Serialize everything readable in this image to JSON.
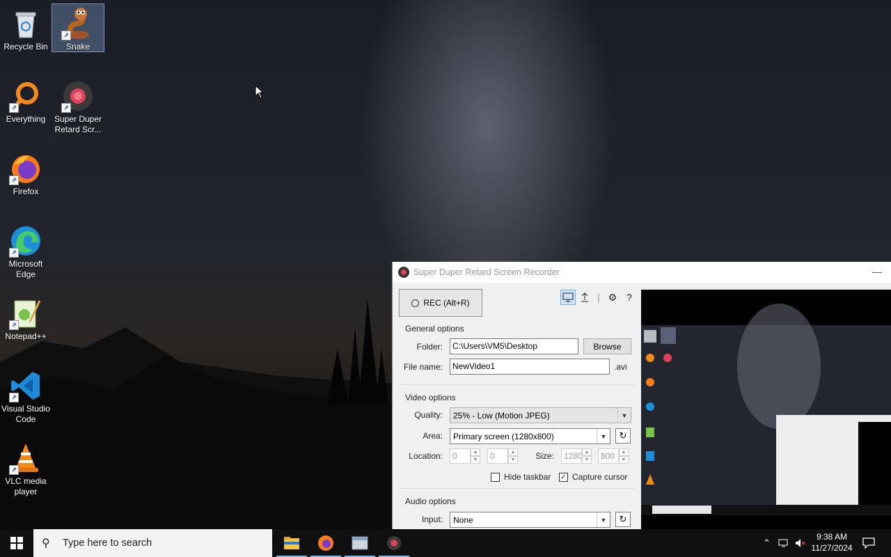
{
  "desktop": {
    "icons": [
      {
        "label": "Recycle Bin"
      },
      {
        "label": "Snake"
      },
      {
        "label": "Everything"
      },
      {
        "label": "Super Duper Retard Scr..."
      },
      {
        "label": "Firefox"
      },
      {
        "label": "Microsoft Edge"
      },
      {
        "label": "Notepad++"
      },
      {
        "label": "Visual Studio Code"
      },
      {
        "label": "VLC media player"
      }
    ]
  },
  "app": {
    "title": "Super Duper Retard Screen Recorder",
    "rec_label": "REC (Alt+R)",
    "general": {
      "heading": "General options",
      "folder_label": "Folder:",
      "folder_value": "C:\\Users\\VM5\\Desktop",
      "browse_label": "Browse",
      "filename_label": "File name:",
      "filename_value": "NewVideo1",
      "extension": ".avi"
    },
    "video": {
      "heading": "Video options",
      "quality_label": "Quality:",
      "quality_value": "25% - Low (Motion JPEG)",
      "area_label": "Area:",
      "area_value": "Primary screen (1280x800)",
      "location_label": "Location:",
      "loc_x": "0",
      "loc_y": "0",
      "size_label": "Size:",
      "size_w": "1280",
      "size_h": "800",
      "hide_taskbar_label": "Hide taskbar",
      "hide_taskbar_checked": false,
      "capture_cursor_label": "Capture cursor",
      "capture_cursor_checked": true
    },
    "audio": {
      "heading": "Audio options",
      "input_label": "Input:",
      "input_value": "None"
    }
  },
  "taskbar": {
    "search_placeholder": "Type here to search",
    "time": "9:38 AM",
    "date": "11/27/2024",
    "accent": "#76b9ed"
  }
}
